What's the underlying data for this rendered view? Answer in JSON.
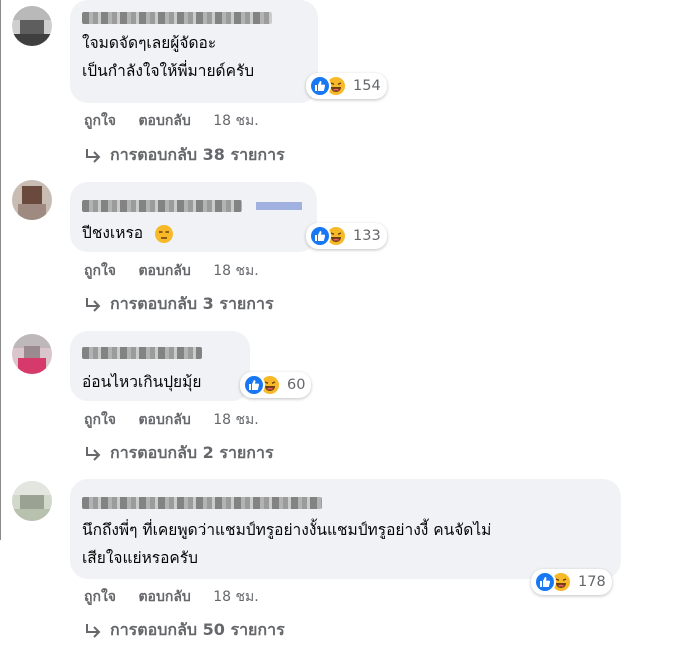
{
  "comments": [
    {
      "text_lines": [
        "ใจมดจัดๆเลยผู้จัดอะ",
        "เป็นกำลังใจให้พี่มายด์ครับ"
      ],
      "reaction_count": "154",
      "like_label": "ถูกใจ",
      "reply_label": "ตอบกลับ",
      "time": "18 ชม.",
      "replies_label": "การตอบกลับ 38 รายการ"
    },
    {
      "text_lines": [
        "ปีชงเหรอ"
      ],
      "inline_emoji": "unamused-face-icon",
      "reaction_count": "133",
      "like_label": "ถูกใจ",
      "reply_label": "ตอบกลับ",
      "time": "18 ชม.",
      "replies_label": "การตอบกลับ 3 รายการ"
    },
    {
      "text_lines": [
        "อ่อนไหวเกินปุยมุ้ย"
      ],
      "reaction_count": "60",
      "like_label": "ถูกใจ",
      "reply_label": "ตอบกลับ",
      "time": "18 ชม.",
      "replies_label": "การตอบกลับ 2 รายการ"
    },
    {
      "text_lines": [
        "นึกถึงพี่ๆ ที่เคยพูดว่าแชมป์ทรูอย่างงั้นแชมป์ทรูอย่างงี้ คนจัดไม่",
        "เสียใจแย่หรอครับ"
      ],
      "reaction_count": "178",
      "like_label": "ถูกใจ",
      "reply_label": "ตอบกลับ",
      "time": "18 ชม.",
      "replies_label": "การตอบกลับ 50 รายการ"
    }
  ],
  "icons": {
    "reaction_like": "thumbs-up-icon",
    "reaction_haha": "laughing-face-icon",
    "reply_arrow": "reply-arrow-icon"
  },
  "colors": {
    "bubble": "#f0f2f5",
    "secondary_text": "#65676b",
    "like_blue": "#1877f2",
    "haha_yellow": "#f7b928"
  }
}
